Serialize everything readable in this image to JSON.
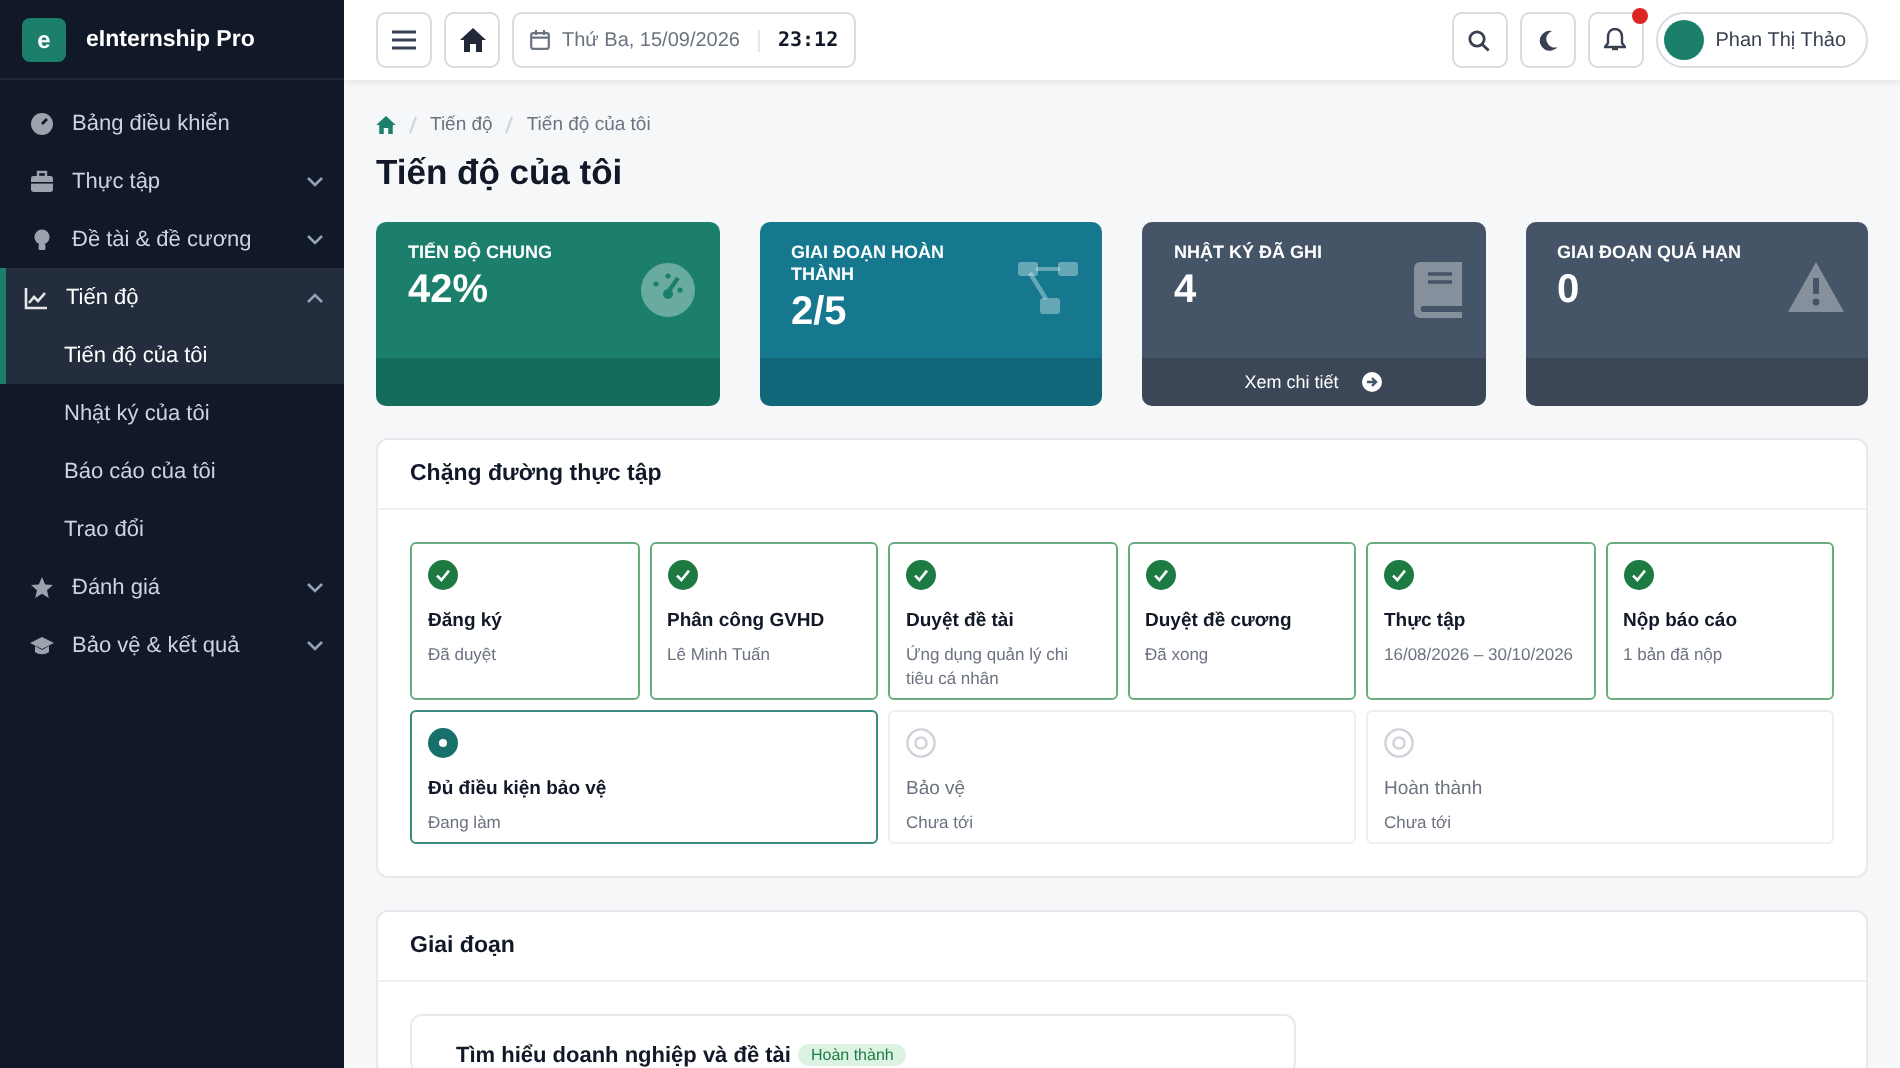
{
  "app": {
    "logo_letter": "e",
    "name": "eInternship Pro"
  },
  "sidebar": {
    "items": [
      {
        "label": "Bảng điều khiển",
        "selected": false
      },
      {
        "label": "Thực tập",
        "expanded": false,
        "selected": false
      },
      {
        "label": "Đề tài & đề cương",
        "expanded": false,
        "selected": false
      },
      {
        "label": "Tiến độ",
        "expanded": true,
        "selected": true,
        "children": [
          {
            "label": "Tiến độ của tôi",
            "selected": true
          },
          {
            "label": "Nhật ký của tôi",
            "selected": false
          },
          {
            "label": "Báo cáo của tôi",
            "selected": false
          },
          {
            "label": "Trao đổi",
            "selected": false
          }
        ]
      },
      {
        "label": "Đánh giá",
        "expanded": false,
        "selected": false
      },
      {
        "label": "Bảo vệ & kết quả",
        "expanded": false,
        "selected": false
      }
    ]
  },
  "topbar": {
    "date": "Thứ Ba, 15/09/2026",
    "time": "23:12",
    "user": "Phan Thị Thảo"
  },
  "breadcrumb": [
    "Tiến độ",
    "Tiến độ của tôi"
  ],
  "page_title": "Tiến độ của tôi",
  "stats": [
    {
      "label": "TIẾN ĐỘ CHUNG",
      "value": "42%",
      "color": "#1b7f6c"
    },
    {
      "label": "GIAI ĐOẠN HOÀN THÀNH",
      "value": "2/5",
      "color": "#15788f"
    },
    {
      "label": "NHẬT KÝ ĐÃ GHI",
      "value": "4",
      "color": "#465467",
      "link": "Xem chi tiết"
    },
    {
      "label": "GIAI ĐOẠN QUÁ HẠN",
      "value": "0",
      "color": "#465467"
    }
  ],
  "milestones": {
    "title": "Chặng đường thực tập",
    "items": [
      {
        "kind": "done",
        "title": "Đăng ký",
        "detail": "Đã duyệt"
      },
      {
        "kind": "done",
        "title": "Phân công GVHD",
        "detail": "Lê Minh Tuấn"
      },
      {
        "kind": "done",
        "title": "Duyệt đề tài",
        "detail": "Ứng dụng quản lý chi tiêu cá nhân"
      },
      {
        "kind": "done",
        "title": "Duyệt đề cương",
        "detail": "Đã xong"
      },
      {
        "kind": "done",
        "title": "Thực tập",
        "detail": "16/08/2026 – 30/10/2026"
      },
      {
        "kind": "done",
        "title": "Nộp báo cáo",
        "detail": "1 bản đã nộp"
      },
      {
        "kind": "current",
        "title": "Đủ điều kiện bảo vệ",
        "detail": "Đang làm"
      },
      {
        "kind": "pending",
        "title": "Bảo vệ",
        "detail": "Chưa tới"
      },
      {
        "kind": "pending",
        "title": "Hoàn thành",
        "detail": "Chưa tới"
      }
    ]
  },
  "phases": {
    "title": "Giai đoạn",
    "items": [
      {
        "title": "Tìm hiểu doanh nghiệp và đề tài",
        "badge": "Hoàn thành"
      }
    ]
  }
}
